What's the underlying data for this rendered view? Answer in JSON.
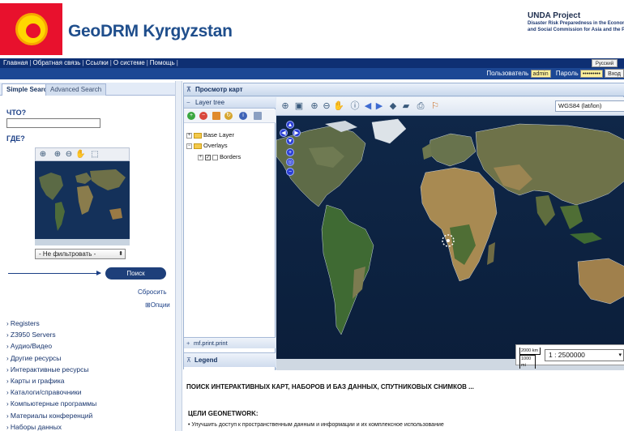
{
  "header": {
    "site_title": "GeoDRM Kyrgyzstan",
    "partner_title": "UNDA Project",
    "partner_subtitle_1": "Disaster Risk Preparedness in the Economic",
    "partner_subtitle_2": "and Social Commission for Asia and the Pacific"
  },
  "nav": {
    "items": [
      "Главная",
      "Обратная связь",
      "Ссылки",
      "О системе",
      "Помощь"
    ],
    "language": "Русский"
  },
  "login": {
    "user_label": "Пользователь",
    "user_value": "admin",
    "password_label": "Пароль",
    "password_value": "•••••••••",
    "button_label": "Вход"
  },
  "search": {
    "tab_simple": "Simple Search",
    "tab_advanced": "Advanced Search",
    "what_label": "ЧТО?",
    "what_value": "",
    "where_label": "ГДЕ?",
    "filter_value": "- Не фильтровать -",
    "search_button": "Поиск",
    "reset_link": "Сбросить",
    "options_link": "⊞Опции"
  },
  "categories": [
    "Registers",
    "Z3950 Servers",
    "Аудио/Видео",
    "Другие ресурсы",
    "Интерактивные ресурсы",
    "Карты и графика",
    "Каталоги/справочники",
    "Компьютерные программы",
    "Материалы конференций",
    "Наборы данных"
  ],
  "viewer": {
    "title": "Просмотр карт",
    "layer_tree_title": "Layer tree",
    "layers": {
      "base": "Base Layer",
      "overlays": "Overlays",
      "borders": "Borders"
    },
    "print_label": "mf.print.print",
    "legend_label": "Legend",
    "crs": "WGS84 (lat/lon)",
    "scale_top": "2000 km",
    "scale_bottom": "1000 mi",
    "scale_value": "1 : 2500000"
  },
  "content": {
    "heading": "ПОИСК ИНТЕРАКТИВНЫХ КАРТ, НАБОРОВ И БАЗ ДАННЫХ, СПУТНИКОВЫХ СНИМКОВ ...",
    "goals_heading": "ЦЕЛИ GEONETWORK:",
    "goal_1": "• Улучшить доступ к пространственным данным и информации и их комплексное использование"
  },
  "colors": {
    "brand_blue": "#1f4e8c",
    "nav_bar": "#0e2f73",
    "flag_red": "#e8112d",
    "flag_sun": "#ffd700"
  }
}
